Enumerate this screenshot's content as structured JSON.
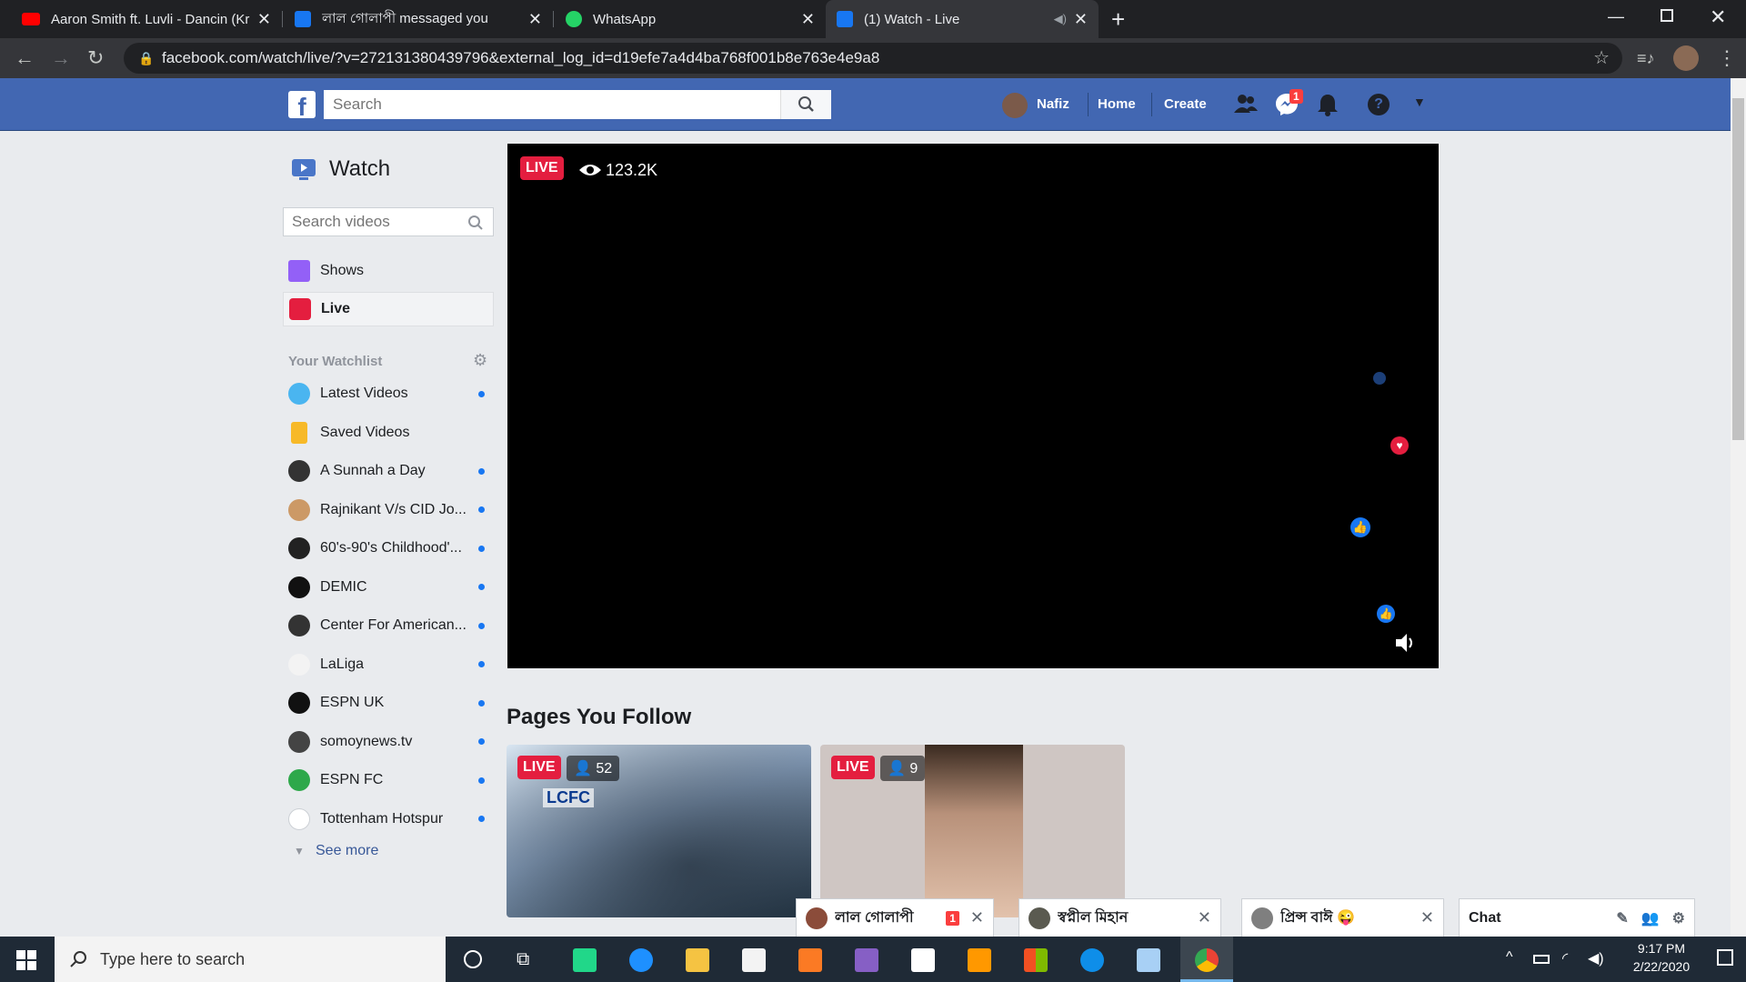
{
  "browser": {
    "tabs": [
      {
        "title": "Aaron Smith ft. Luvli - Dancin (Kr",
        "icon": "youtube-icon"
      },
      {
        "title": "লাল গোলাপী messaged you",
        "icon": "facebook-icon"
      },
      {
        "title": "WhatsApp",
        "icon": "whatsapp-icon"
      },
      {
        "title": "(1) Watch - Live",
        "icon": "facebook-icon"
      }
    ],
    "url": "facebook.com/watch/live/?v=272131380439796&external_log_id=d19efe7a4d4ba768f001b8e763e4e9a8"
  },
  "fb": {
    "search_placeholder": "Search",
    "user_name": "Nafiz",
    "nav_home": "Home",
    "nav_create": "Create",
    "messenger_badge": "1"
  },
  "sidebar": {
    "title": "Watch",
    "search_placeholder": "Search videos",
    "items": [
      {
        "label": "Shows"
      },
      {
        "label": "Live"
      }
    ],
    "watchlist_header": "Your Watchlist",
    "watchlist": [
      {
        "label": "Latest Videos",
        "dot": true
      },
      {
        "label": "Saved Videos",
        "dot": false
      },
      {
        "label": "A Sunnah a Day",
        "dot": true
      },
      {
        "label": "Rajnikant V/s CID Jo...",
        "dot": true
      },
      {
        "label": "60's-90's Childhood'...",
        "dot": true
      },
      {
        "label": "DEMIC",
        "dot": true
      },
      {
        "label": "Center For American...",
        "dot": true
      },
      {
        "label": "LaLiga",
        "dot": true
      },
      {
        "label": "ESPN UK",
        "dot": true
      },
      {
        "label": "somoynews.tv",
        "dot": true
      },
      {
        "label": "ESPN FC",
        "dot": true
      },
      {
        "label": "Tottenham Hotspur",
        "dot": true
      }
    ],
    "see_more": "See more"
  },
  "video": {
    "live_label": "LIVE",
    "viewers": "123.2K"
  },
  "pages_section": {
    "title": "Pages You Follow",
    "cards": [
      {
        "live": "LIVE",
        "viewers": "52",
        "overlay_text": "LCFC"
      },
      {
        "live": "LIVE",
        "viewers": "9"
      }
    ]
  },
  "chat": {
    "conversations": [
      {
        "name": "লাল গোলাপী",
        "unread": "1"
      },
      {
        "name": "স্বপ্নীল মিহান"
      },
      {
        "name": "প্রিন্স বাঈ 😜"
      }
    ],
    "chat_label": "Chat"
  },
  "taskbar": {
    "search_placeholder": "Type here to search",
    "time": "9:17 PM",
    "date": "2/22/2020"
  },
  "colors": {
    "fb_blue": "#4267b2",
    "live_red": "#e41e3f",
    "dot_blue": "#1877f2"
  }
}
